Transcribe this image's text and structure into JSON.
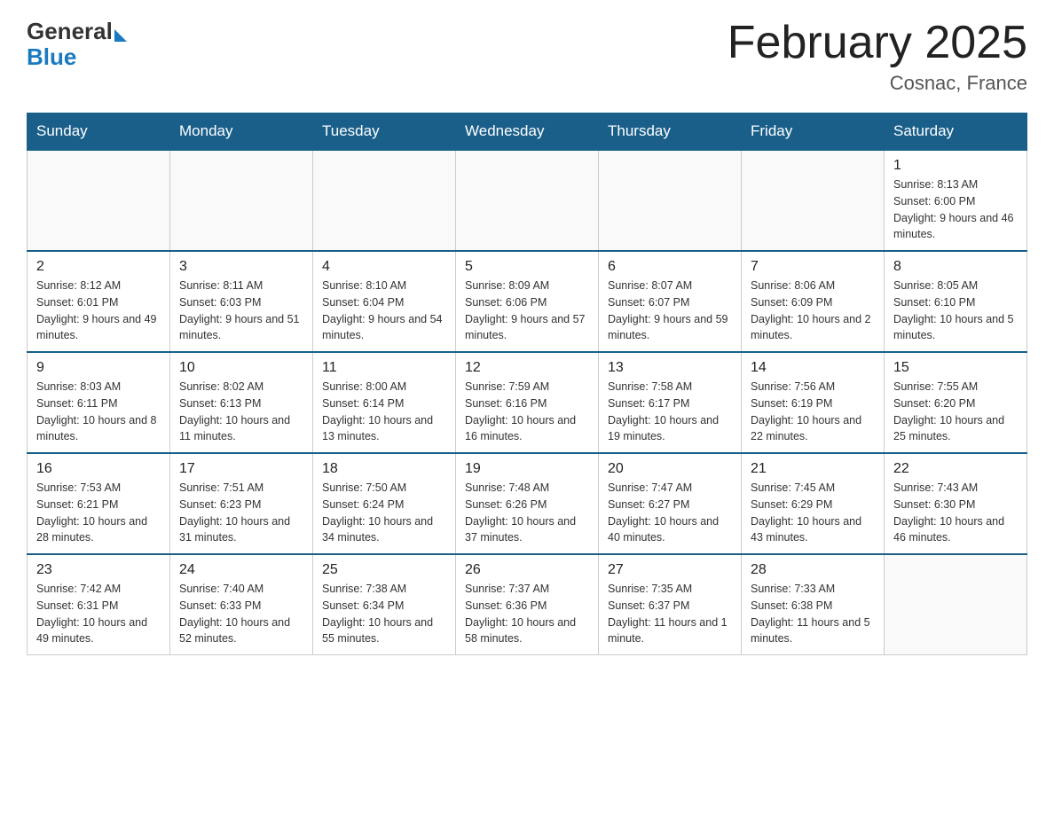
{
  "header": {
    "logo_general": "General",
    "logo_blue": "Blue",
    "title": "February 2025",
    "subtitle": "Cosnac, France"
  },
  "days_of_week": [
    "Sunday",
    "Monday",
    "Tuesday",
    "Wednesday",
    "Thursday",
    "Friday",
    "Saturday"
  ],
  "weeks": [
    [
      {
        "day": "",
        "info": ""
      },
      {
        "day": "",
        "info": ""
      },
      {
        "day": "",
        "info": ""
      },
      {
        "day": "",
        "info": ""
      },
      {
        "day": "",
        "info": ""
      },
      {
        "day": "",
        "info": ""
      },
      {
        "day": "1",
        "info": "Sunrise: 8:13 AM\nSunset: 6:00 PM\nDaylight: 9 hours and 46 minutes."
      }
    ],
    [
      {
        "day": "2",
        "info": "Sunrise: 8:12 AM\nSunset: 6:01 PM\nDaylight: 9 hours and 49 minutes."
      },
      {
        "day": "3",
        "info": "Sunrise: 8:11 AM\nSunset: 6:03 PM\nDaylight: 9 hours and 51 minutes."
      },
      {
        "day": "4",
        "info": "Sunrise: 8:10 AM\nSunset: 6:04 PM\nDaylight: 9 hours and 54 minutes."
      },
      {
        "day": "5",
        "info": "Sunrise: 8:09 AM\nSunset: 6:06 PM\nDaylight: 9 hours and 57 minutes."
      },
      {
        "day": "6",
        "info": "Sunrise: 8:07 AM\nSunset: 6:07 PM\nDaylight: 9 hours and 59 minutes."
      },
      {
        "day": "7",
        "info": "Sunrise: 8:06 AM\nSunset: 6:09 PM\nDaylight: 10 hours and 2 minutes."
      },
      {
        "day": "8",
        "info": "Sunrise: 8:05 AM\nSunset: 6:10 PM\nDaylight: 10 hours and 5 minutes."
      }
    ],
    [
      {
        "day": "9",
        "info": "Sunrise: 8:03 AM\nSunset: 6:11 PM\nDaylight: 10 hours and 8 minutes."
      },
      {
        "day": "10",
        "info": "Sunrise: 8:02 AM\nSunset: 6:13 PM\nDaylight: 10 hours and 11 minutes."
      },
      {
        "day": "11",
        "info": "Sunrise: 8:00 AM\nSunset: 6:14 PM\nDaylight: 10 hours and 13 minutes."
      },
      {
        "day": "12",
        "info": "Sunrise: 7:59 AM\nSunset: 6:16 PM\nDaylight: 10 hours and 16 minutes."
      },
      {
        "day": "13",
        "info": "Sunrise: 7:58 AM\nSunset: 6:17 PM\nDaylight: 10 hours and 19 minutes."
      },
      {
        "day": "14",
        "info": "Sunrise: 7:56 AM\nSunset: 6:19 PM\nDaylight: 10 hours and 22 minutes."
      },
      {
        "day": "15",
        "info": "Sunrise: 7:55 AM\nSunset: 6:20 PM\nDaylight: 10 hours and 25 minutes."
      }
    ],
    [
      {
        "day": "16",
        "info": "Sunrise: 7:53 AM\nSunset: 6:21 PM\nDaylight: 10 hours and 28 minutes."
      },
      {
        "day": "17",
        "info": "Sunrise: 7:51 AM\nSunset: 6:23 PM\nDaylight: 10 hours and 31 minutes."
      },
      {
        "day": "18",
        "info": "Sunrise: 7:50 AM\nSunset: 6:24 PM\nDaylight: 10 hours and 34 minutes."
      },
      {
        "day": "19",
        "info": "Sunrise: 7:48 AM\nSunset: 6:26 PM\nDaylight: 10 hours and 37 minutes."
      },
      {
        "day": "20",
        "info": "Sunrise: 7:47 AM\nSunset: 6:27 PM\nDaylight: 10 hours and 40 minutes."
      },
      {
        "day": "21",
        "info": "Sunrise: 7:45 AM\nSunset: 6:29 PM\nDaylight: 10 hours and 43 minutes."
      },
      {
        "day": "22",
        "info": "Sunrise: 7:43 AM\nSunset: 6:30 PM\nDaylight: 10 hours and 46 minutes."
      }
    ],
    [
      {
        "day": "23",
        "info": "Sunrise: 7:42 AM\nSunset: 6:31 PM\nDaylight: 10 hours and 49 minutes."
      },
      {
        "day": "24",
        "info": "Sunrise: 7:40 AM\nSunset: 6:33 PM\nDaylight: 10 hours and 52 minutes."
      },
      {
        "day": "25",
        "info": "Sunrise: 7:38 AM\nSunset: 6:34 PM\nDaylight: 10 hours and 55 minutes."
      },
      {
        "day": "26",
        "info": "Sunrise: 7:37 AM\nSunset: 6:36 PM\nDaylight: 10 hours and 58 minutes."
      },
      {
        "day": "27",
        "info": "Sunrise: 7:35 AM\nSunset: 6:37 PM\nDaylight: 11 hours and 1 minute."
      },
      {
        "day": "28",
        "info": "Sunrise: 7:33 AM\nSunset: 6:38 PM\nDaylight: 11 hours and 5 minutes."
      },
      {
        "day": "",
        "info": ""
      }
    ]
  ]
}
